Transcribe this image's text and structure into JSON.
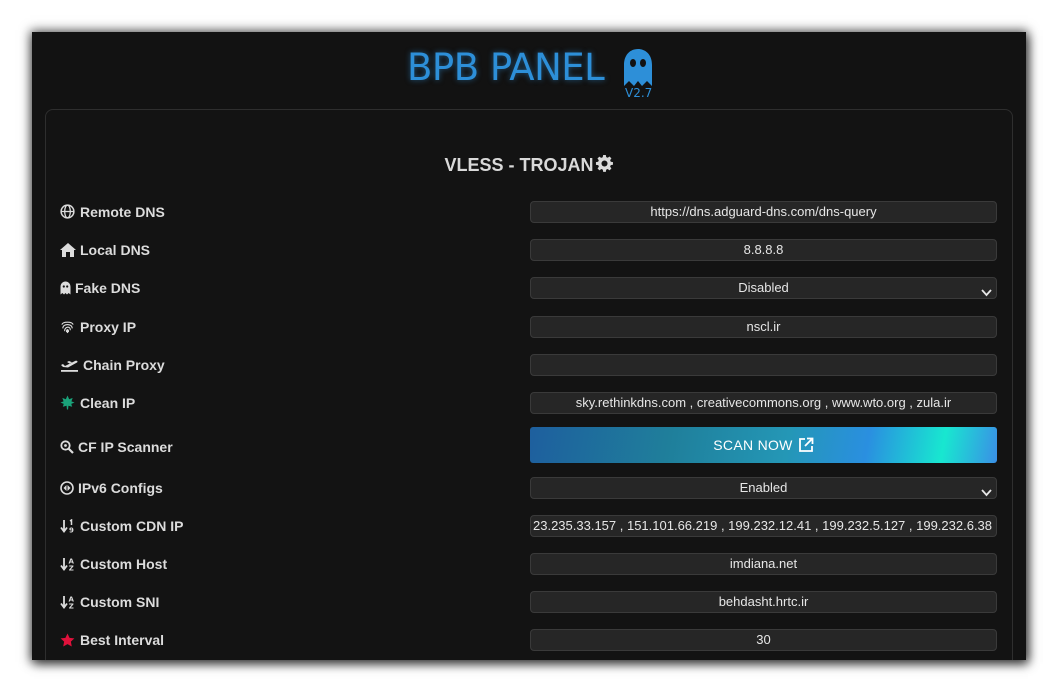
{
  "brand": {
    "name": "BPB PANEL",
    "version": "V2.7"
  },
  "section": {
    "title": "VLESS - TROJAN"
  },
  "rows": {
    "remote_dns": {
      "label": "Remote DNS",
      "value": "https://dns.adguard-dns.com/dns-query",
      "icon": "globe-icon"
    },
    "local_dns": {
      "label": "Local DNS",
      "value": "8.8.8.8",
      "icon": "home-icon"
    },
    "fake_dns": {
      "label": "Fake DNS",
      "value": "Disabled",
      "icon": "ghost-icon"
    },
    "proxy_ip": {
      "label": "Proxy IP",
      "value": "nscl.ir",
      "icon": "fingerprint-icon"
    },
    "chain_proxy": {
      "label": "Chain Proxy",
      "value": "",
      "icon": "plane-departure-icon"
    },
    "clean_ip": {
      "label": "Clean IP",
      "value": "sky.rethinkdns.com , creativecommons.org , www.wto.org , zula.ir",
      "icon": "leaf-icon"
    },
    "cf_ip_scanner": {
      "label": "CF IP Scanner",
      "button": "SCAN NOW",
      "icon": "magnify-gear-icon"
    },
    "ipv6_configs": {
      "label": "IPv6 Configs",
      "value": "Enabled",
      "icon": "ipv6-icon"
    },
    "custom_cdn_ip": {
      "label": "Custom CDN IP",
      "value": "23.235.33.157 , 151.101.66.219 , 199.232.12.41 , 199.232.5.127 , 199.232.6.38 ,",
      "icon": "sort-numeric-icon"
    },
    "custom_host": {
      "label": "Custom Host",
      "value": "imdiana.net",
      "icon": "sort-alpha-icon"
    },
    "custom_sni": {
      "label": "Custom SNI",
      "value": "behdasht.hrtc.ir",
      "icon": "sort-alpha-icon"
    },
    "best_interval": {
      "label": "Best Interval",
      "value": "30",
      "icon": "star-icon"
    }
  },
  "colors": {
    "background": "#121212",
    "brand": "#2d8fd8",
    "leaf": "#1aa37a",
    "star": "#e0113b",
    "field_bg": "#262626"
  }
}
